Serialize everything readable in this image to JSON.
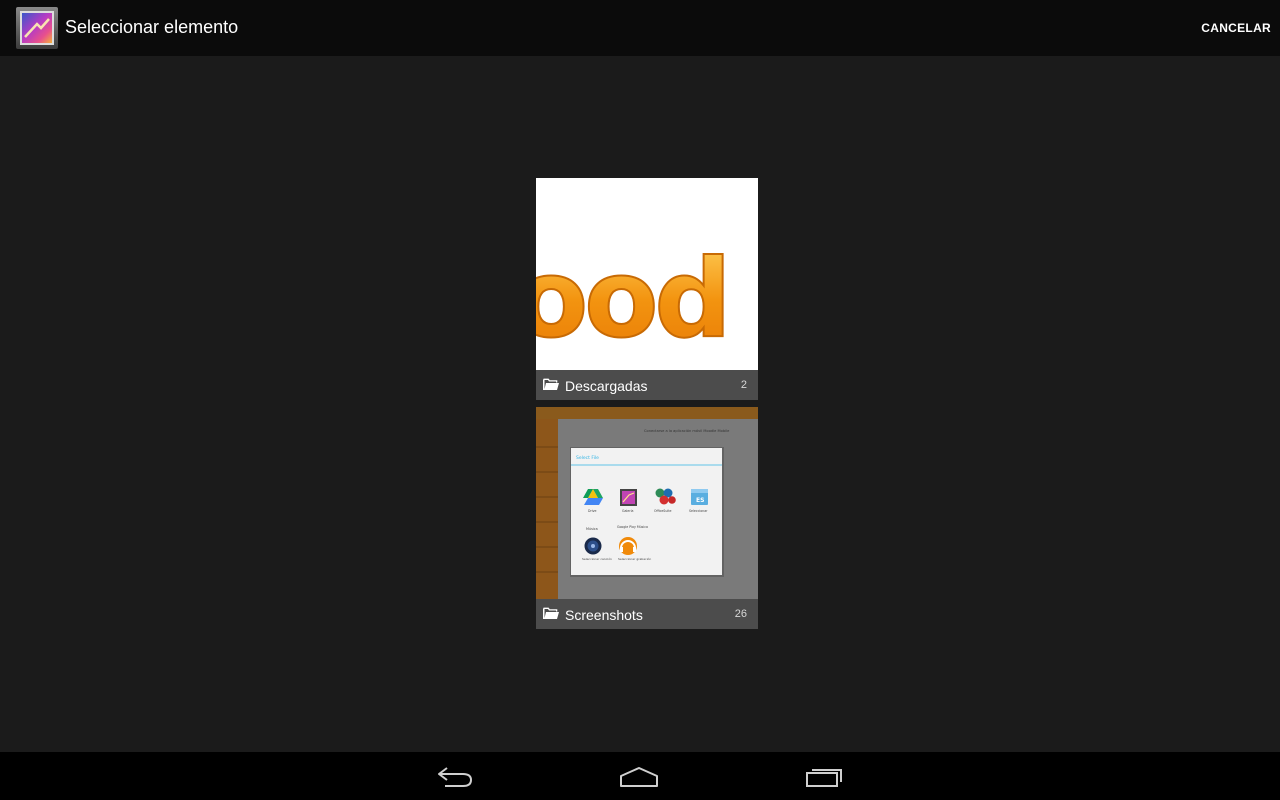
{
  "action_bar": {
    "title": "Seleccionar elemento",
    "cancel_label": "CANCELAR",
    "app_icon": "gallery-icon"
  },
  "albums": [
    {
      "name": "Descargadas",
      "count": "2",
      "thumbnail_text": "ood",
      "icon": "folder-icon"
    },
    {
      "name": "Screenshots",
      "count": "26",
      "icon": "folder-icon",
      "thumbnail": {
        "top_text": "Conectarse a la aplicación móvil Moodle Mobile",
        "dialog_title": "Select File",
        "apps": [
          {
            "label": "Drive",
            "icon": "drive-icon"
          },
          {
            "label": "Galería",
            "icon": "gallery-icon"
          },
          {
            "label": "OfficeSuite",
            "icon": "officesuite-icon"
          },
          {
            "label": "Seleccionar",
            "icon": "es-file-explorer-icon"
          },
          {
            "label": "Seleccionar canción",
            "top_label": "Música",
            "icon": "music-icon"
          },
          {
            "label": "Seleccionar grabación",
            "top_label": "Google Play Música",
            "icon": "play-music-icon"
          }
        ]
      }
    }
  ],
  "nav_bar": {
    "back": "back-icon",
    "home": "home-icon",
    "recent": "recent-apps-icon"
  },
  "colors": {
    "background": "#1b1b1b",
    "action_bar": "#0b0b0b",
    "nav_bar": "#000000",
    "album_bar": "#505050",
    "accent_orange": "#f0900a",
    "dialog_accent": "#33b5e5"
  }
}
